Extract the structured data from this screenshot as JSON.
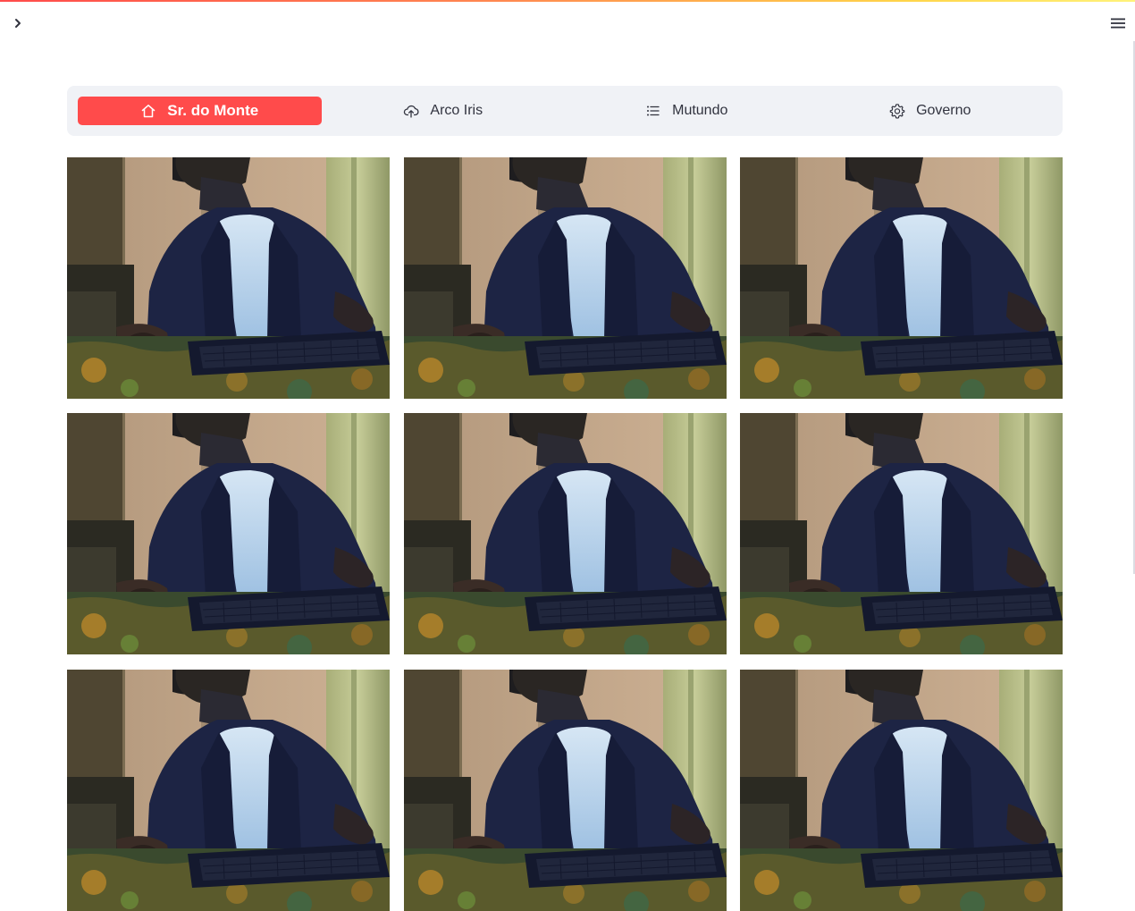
{
  "tabs": [
    {
      "label": "Sr. do Monte",
      "icon": "home-icon",
      "active": true
    },
    {
      "label": "Arco Iris",
      "icon": "cloud-upload-icon",
      "active": false
    },
    {
      "label": "Mutundo",
      "icon": "list-icon",
      "active": false
    },
    {
      "label": "Governo",
      "icon": "gear-icon",
      "active": false
    }
  ],
  "colors": {
    "accent": "#ff4b4b",
    "nav_background": "#f0f2f6",
    "text": "#31333f"
  },
  "gallery": {
    "image_count": 9,
    "columns": 3
  }
}
